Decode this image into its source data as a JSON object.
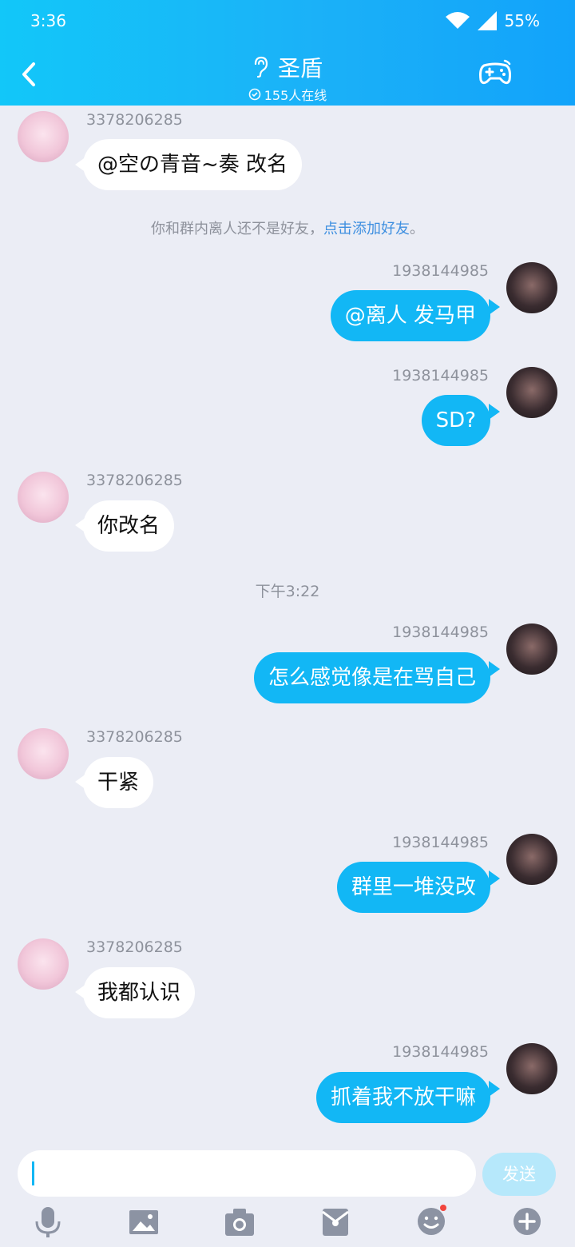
{
  "status": {
    "time": "3:36",
    "battery": "55%"
  },
  "header": {
    "title": "圣盾",
    "online": "155人在线"
  },
  "messages": [
    {
      "side": "left",
      "uid": "3378206285",
      "text": "@空の青音~奏 改名"
    },
    {
      "side": "right",
      "uid": "1938144985",
      "text": "@离人 发马甲"
    },
    {
      "side": "right",
      "uid": "1938144985",
      "text": "SD?"
    },
    {
      "side": "left",
      "uid": "3378206285",
      "text": "你改名"
    },
    {
      "side": "right",
      "uid": "1938144985",
      "text": "怎么感觉像是在骂自己"
    },
    {
      "side": "left",
      "uid": "3378206285",
      "text": "干紧"
    },
    {
      "side": "right",
      "uid": "1938144985",
      "text": "群里一堆没改"
    },
    {
      "side": "left",
      "uid": "3378206285",
      "text": "我都认识"
    },
    {
      "side": "right",
      "uid": "1938144985",
      "text": "抓着我不放干嘛"
    }
  ],
  "notice": {
    "prefix": "你和群内离人还不是好友，",
    "link": "点击添加好友",
    "suffix": "。"
  },
  "time_separator": "下午3:22",
  "input": {
    "placeholder": "",
    "send_label": "发送"
  },
  "toolbar": [
    "mic-icon",
    "image-icon",
    "camera-icon",
    "red-packet-icon",
    "emoji-icon",
    "plus-icon"
  ],
  "colors": {
    "header_start": "#12C7F9",
    "header_end": "#12A3FA",
    "bubble_self": "#12B7F5",
    "link": "#3E8FE0"
  }
}
